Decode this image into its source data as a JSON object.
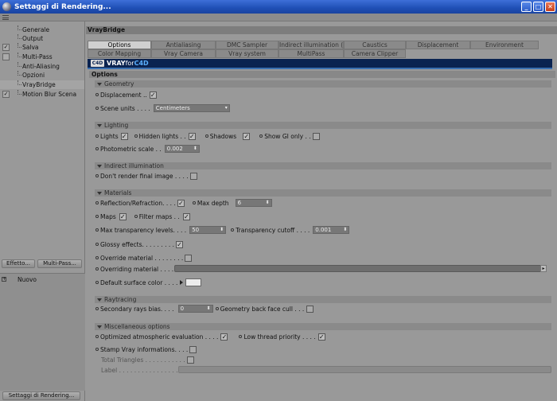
{
  "window": {
    "title": "Settaggi di Rendering..."
  },
  "sidebar": {
    "items": [
      {
        "label": "Generale",
        "checked": ""
      },
      {
        "label": "Output",
        "checked": ""
      },
      {
        "label": "Salva",
        "checked": "✓"
      },
      {
        "label": "Multi-Pass",
        "checked": ""
      },
      {
        "label": "Anti-Aliasing",
        "checked": ""
      },
      {
        "label": "Opzioni",
        "checked": ""
      },
      {
        "label": "VrayBridge",
        "checked": ""
      },
      {
        "label": "Motion Blur Scena",
        "checked": "✓"
      }
    ],
    "effect_button": "Effetto...",
    "multipass_button": "Multi-Pass...",
    "scene_item": "Nuovo",
    "bottom_button": "Settaggi di Rendering..."
  },
  "main": {
    "plugin_title": "VrayBridge",
    "tabs_row1": [
      "Options",
      "Antialiasing",
      "DMC Sampler",
      "Indirect illumination (GI)",
      "Caustics",
      "Displacement",
      "Environment"
    ],
    "tabs_row2": [
      "Color Mapping",
      "Vray Camera",
      "Vray system",
      "MultiPass",
      "Camera Clipper"
    ],
    "brand_a": "VRAY",
    "brand_b": "for",
    "brand_c": "C4D",
    "c4d_icon": "C4D",
    "section_title": "Options",
    "geometry": {
      "header": "Geometry",
      "displacement": "Displacement ..",
      "scene_units": "Scene units . . . .",
      "scene_units_value": "Centimeters"
    },
    "lighting": {
      "header": "Lighting",
      "lights": "Lights",
      "hidden_lights": "Hidden lights . .",
      "shadows": "Shadows",
      "show_gi_only": "Show GI only . .",
      "photometric_scale": "Photometric scale . .",
      "photometric_value": "0.002"
    },
    "indirect": {
      "header": "Indirect illumination",
      "dont_render": "Don't render final image . . . ."
    },
    "materials": {
      "header": "Materials",
      "reflection": "Reflection/Refraction. . . .",
      "max_depth": "Max depth",
      "max_depth_value": "6",
      "maps": "Maps",
      "filter_maps": "Filter maps . .",
      "max_transp": "Max transparency levels. . . .",
      "max_transp_value": "50",
      "transp_cutoff": "Transparency cutoff . . . .",
      "transp_cutoff_value": "0.001",
      "glossy": "Glossy effects. . . . . . . . .",
      "override_material": "Override material . . . . . . . .",
      "overriding_material": "Overriding material . . . . . . .",
      "default_surface": "Default surface color . . . ."
    },
    "raytracing": {
      "header": "Raytracing",
      "secondary_bias": "Secondary rays bias. . . .",
      "secondary_bias_value": "0",
      "geometry_backface": "Geometry back face cull . . ."
    },
    "misc": {
      "header": "Miscellaneous options",
      "atmospheric": "Optimized atmospheric evaluation . . . .",
      "low_thread": "Low thread priority . . . .",
      "stamp": "Stamp Vray informations. . . .",
      "total_triangles": "Total Triangles . . . . . . . . . . .",
      "label": "Label . . . . . . . . . . . . . . . . . . ."
    }
  },
  "colors": {
    "accent": "#1f4fb5",
    "banner": "#0a2350",
    "panel": "#999999"
  }
}
